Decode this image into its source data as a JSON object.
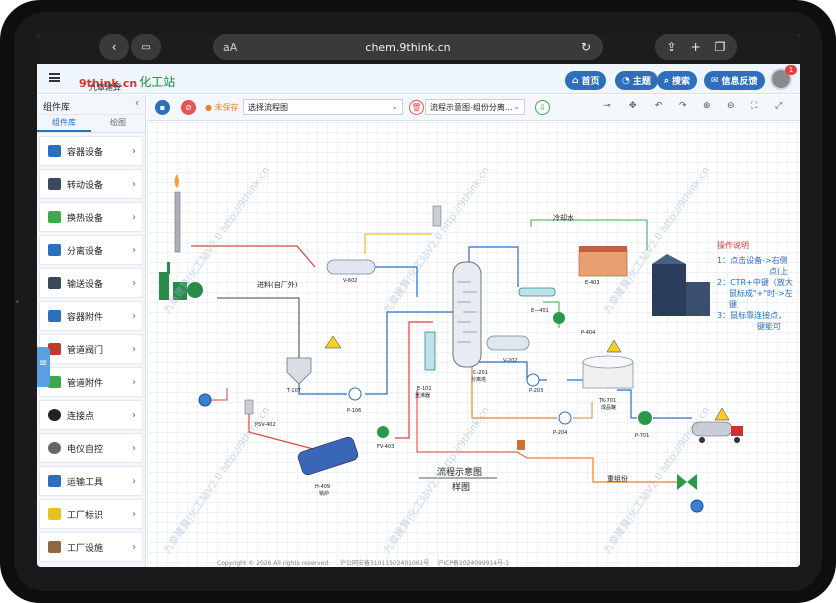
{
  "browser": {
    "aa": "aA",
    "url": "chem.9think.cn"
  },
  "header": {
    "logo_brand": "9think.cn",
    "logo_cn": "化工站",
    "logo_sub": "九章建算",
    "nav": [
      "首页",
      "主题",
      "搜索",
      "信息反馈"
    ],
    "badge": "1"
  },
  "sidebar": {
    "title": "组件库",
    "tabs": [
      "组件库",
      "绘图"
    ],
    "items": [
      {
        "label": "容器设备",
        "icon": "vessel-icon"
      },
      {
        "label": "转动设备",
        "icon": "pump-icon"
      },
      {
        "label": "换热设备",
        "icon": "heat-exchanger-icon"
      },
      {
        "label": "分离设备",
        "icon": "separator-icon"
      },
      {
        "label": "输送设备",
        "icon": "conveyor-icon"
      },
      {
        "label": "容器附件",
        "icon": "fitting-icon"
      },
      {
        "label": "管道阀门",
        "icon": "valve-icon"
      },
      {
        "label": "管道附件",
        "icon": "pipe-fitting-icon"
      },
      {
        "label": "连接点",
        "icon": "connector-icon"
      },
      {
        "label": "电仪自控",
        "icon": "instrument-icon"
      },
      {
        "label": "运输工具",
        "icon": "truck-icon"
      },
      {
        "label": "工厂标识",
        "icon": "warning-icon"
      },
      {
        "label": "工厂设施",
        "icon": "building-icon"
      }
    ]
  },
  "toolbar": {
    "unsaved": "● 未保存",
    "flow_select": "选择流程图",
    "diagram_select": "流程示意图-组份分离..."
  },
  "canvas": {
    "labels": {
      "v602": "V-602",
      "feed": "进料(自厂外)",
      "t107": "T-107",
      "p106": "P-106",
      "psv402": "PSV-402",
      "fv403": "FV-403",
      "h409": "H-409",
      "h409b": "锅炉",
      "e101": "E-101",
      "e101b": "重沸器",
      "c201": "C-201",
      "c201b": "分离塔",
      "v202": "V-202",
      "p203": "P-203",
      "p204": "P-204",
      "e401": "E—401",
      "e403": "E-403",
      "p404": "P-404",
      "tk701": "TK-701",
      "tk701b": "成品罐",
      "p701": "P-701",
      "cooling": "冷却水",
      "heavy": "重组份",
      "flow_title": "流程示意图",
      "sample": "样图"
    },
    "ops_title": "操作说明",
    "ops": [
      "1：点击设备->右侧",
      "点(上",
      "2：CTR+中键（放大",
      "鼠标成\"+\"时->左键",
      "3：鼠标靠连接点，",
      "键能可"
    ],
    "watermark": "九章建算|化工站V2.0 http://9think.cn"
  },
  "footer": {
    "copyright": "Copyright © 2026 All rights reserved.",
    "beian1": "沪公网安备31011502401061号",
    "beian2": "沪ICP备2024099914号-1"
  }
}
